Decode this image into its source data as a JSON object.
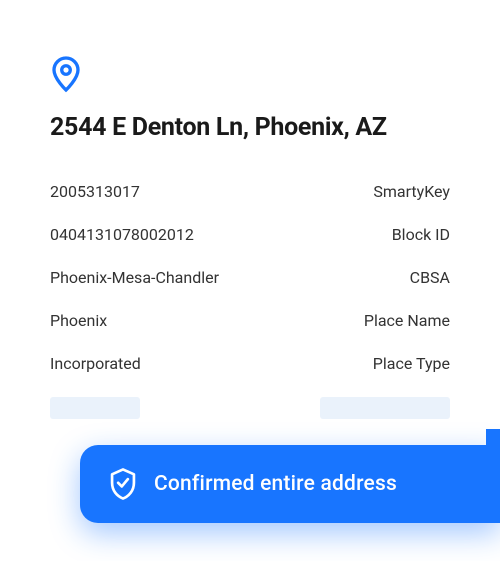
{
  "address": {
    "title": "2544 E Denton Ln, Phoenix, AZ"
  },
  "details": [
    {
      "value": "2005313017",
      "label": "SmartyKey"
    },
    {
      "value": "0404131078002012",
      "label": "Block ID"
    },
    {
      "value": "Phoenix-Mesa-Chandler",
      "label": "CBSA"
    },
    {
      "value": "Phoenix",
      "label": "Place Name"
    },
    {
      "value": "Incorporated",
      "label": "Place Type"
    }
  ],
  "banner": {
    "text": "Confirmed entire address"
  },
  "colors": {
    "accent": "#1875ff",
    "placeholder": "#eaf2fb"
  }
}
